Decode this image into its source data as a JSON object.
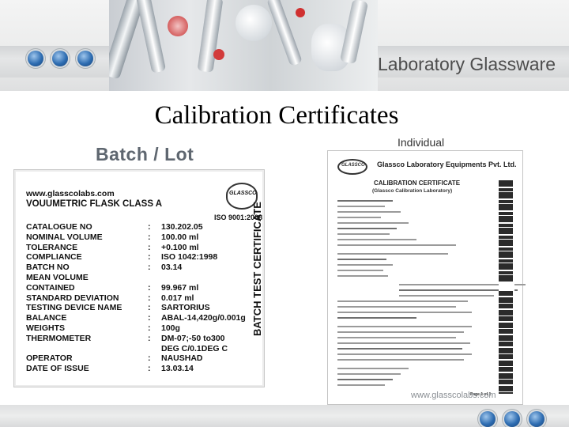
{
  "header": {
    "title": "Laboratory Glassware",
    "colors": {
      "dot": "#2d6cb1",
      "band": "#e1e2e3",
      "title": "#4d4d4d"
    }
  },
  "page": {
    "title": "Calibration Certificates",
    "batch_label": "Batch / Lot",
    "individual_label": "Individual"
  },
  "batch_certificate": {
    "url": "www.glasscolabs.com",
    "heading": "VOUUMETRIC FLASK CLASS A",
    "logo_text": "GLASSCO",
    "iso": "ISO 9001:2008",
    "vertical_title": "BATCH TEST CERTIFICATE",
    "rows": [
      {
        "label": "CATALOGUE NO",
        "sep": ":",
        "value": "130.202.05"
      },
      {
        "label": "NOMINAL VOLUME",
        "sep": ":",
        "value": "100.00 ml"
      },
      {
        "label": "TOLERANCE",
        "sep": ":",
        "value": "+0.100 ml"
      },
      {
        "label": "COMPLIANCE",
        "sep": ":",
        "value": "ISO 1042:1998"
      },
      {
        "label": "BATCH  NO",
        "sep": ":",
        "value": "03.14"
      },
      {
        "label": "MEAN VOLUME",
        "sep": "",
        "value": ""
      },
      {
        "label": "CONTAINED",
        "sep": ":",
        "value": "99.967 ml"
      },
      {
        "label": "STANDARD DEVIATION",
        "sep": ":",
        "value": "0.017 ml"
      },
      {
        "label": "TESTING DEVICE NAME",
        "sep": ":",
        "value": "SARTORIUS"
      },
      {
        "label": "BALANCE",
        "sep": ":",
        "value": "ABAL-14,420g/0.001g"
      },
      {
        "label": "WEIGHTS",
        "sep": ":",
        "value": "100g"
      },
      {
        "label": "THERMOMETER",
        "sep": ":",
        "value": "DM-07;-50 to300"
      },
      {
        "label": "",
        "sep": "",
        "value": "DEG C/0.1DEG C"
      },
      {
        "label": "OPERATOR",
        "sep": ":",
        "value": "NAUSHAD"
      },
      {
        "label": "DATE OF ISSUE",
        "sep": ":",
        "value": "13.03.14"
      }
    ]
  },
  "individual_certificate": {
    "company": "Glassco Laboratory Equipments Pvt. Ltd.",
    "heading": "CALIBRATION CERTIFICATE",
    "subheading": "(Glassco Calibration Laboratory)",
    "logo_text": "GLASSCO",
    "page_number": "Page 1 of 1",
    "footer_url": "www.glasscolabs.com"
  }
}
